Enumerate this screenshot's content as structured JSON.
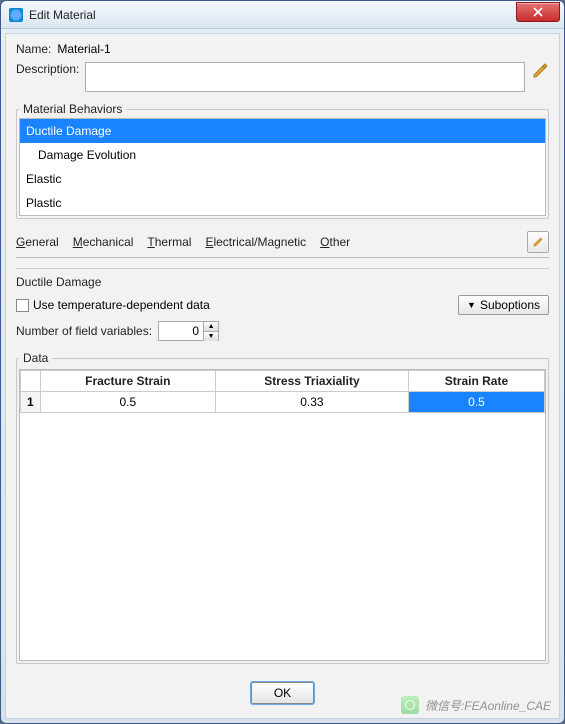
{
  "title": "Edit Material",
  "name_label": "Name:",
  "name_value": "Material-1",
  "description_label": "Description:",
  "description_value": "",
  "behaviors_legend": "Material Behaviors",
  "behaviors": [
    {
      "label": "Ductile Damage",
      "selected": true,
      "sub": false
    },
    {
      "label": "Damage Evolution",
      "selected": false,
      "sub": true
    },
    {
      "label": "Elastic",
      "selected": false,
      "sub": false
    },
    {
      "label": "Plastic",
      "selected": false,
      "sub": false
    }
  ],
  "tabs": {
    "general": "General",
    "mechanical": "Mechanical",
    "thermal": "Thermal",
    "electrical": "Electrical/Magnetic",
    "other": "Other"
  },
  "panel_heading": "Ductile Damage",
  "temp_dep_label": "Use temperature-dependent data",
  "suboptions_label": "Suboptions",
  "field_vars_label": "Number of field variables:",
  "field_vars_value": "0",
  "data_legend": "Data",
  "columns": [
    "Fracture Strain",
    "Stress Triaxiality",
    "Strain Rate"
  ],
  "rows": [
    {
      "num": "1",
      "cells": [
        "0.5",
        "0.33",
        "0.5"
      ],
      "sel_col": 2
    }
  ],
  "ok_label": "OK",
  "watermark_prefix": "微信号:",
  "watermark_name": "FEAonline_CAE"
}
